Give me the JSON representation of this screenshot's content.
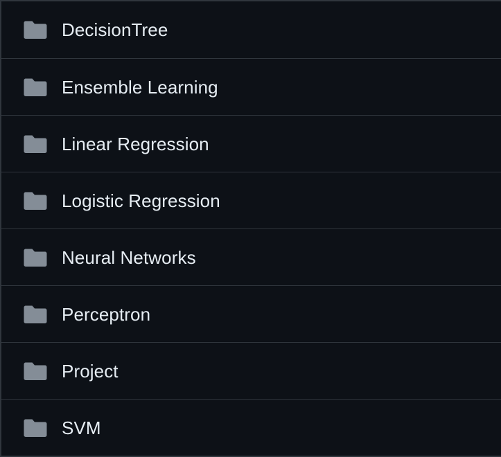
{
  "colors": {
    "background": "#0d1117",
    "border": "#30363d",
    "folder_icon": "#848d97",
    "text": "#e6edf3"
  },
  "directory": {
    "items": [
      {
        "name": "DecisionTree",
        "icon": "folder-icon"
      },
      {
        "name": "Ensemble Learning",
        "icon": "folder-icon"
      },
      {
        "name": "Linear Regression",
        "icon": "folder-icon"
      },
      {
        "name": "Logistic Regression",
        "icon": "folder-icon"
      },
      {
        "name": "Neural Networks",
        "icon": "folder-icon"
      },
      {
        "name": "Perceptron",
        "icon": "folder-icon"
      },
      {
        "name": "Project",
        "icon": "folder-icon"
      },
      {
        "name": "SVM",
        "icon": "folder-icon"
      }
    ]
  }
}
